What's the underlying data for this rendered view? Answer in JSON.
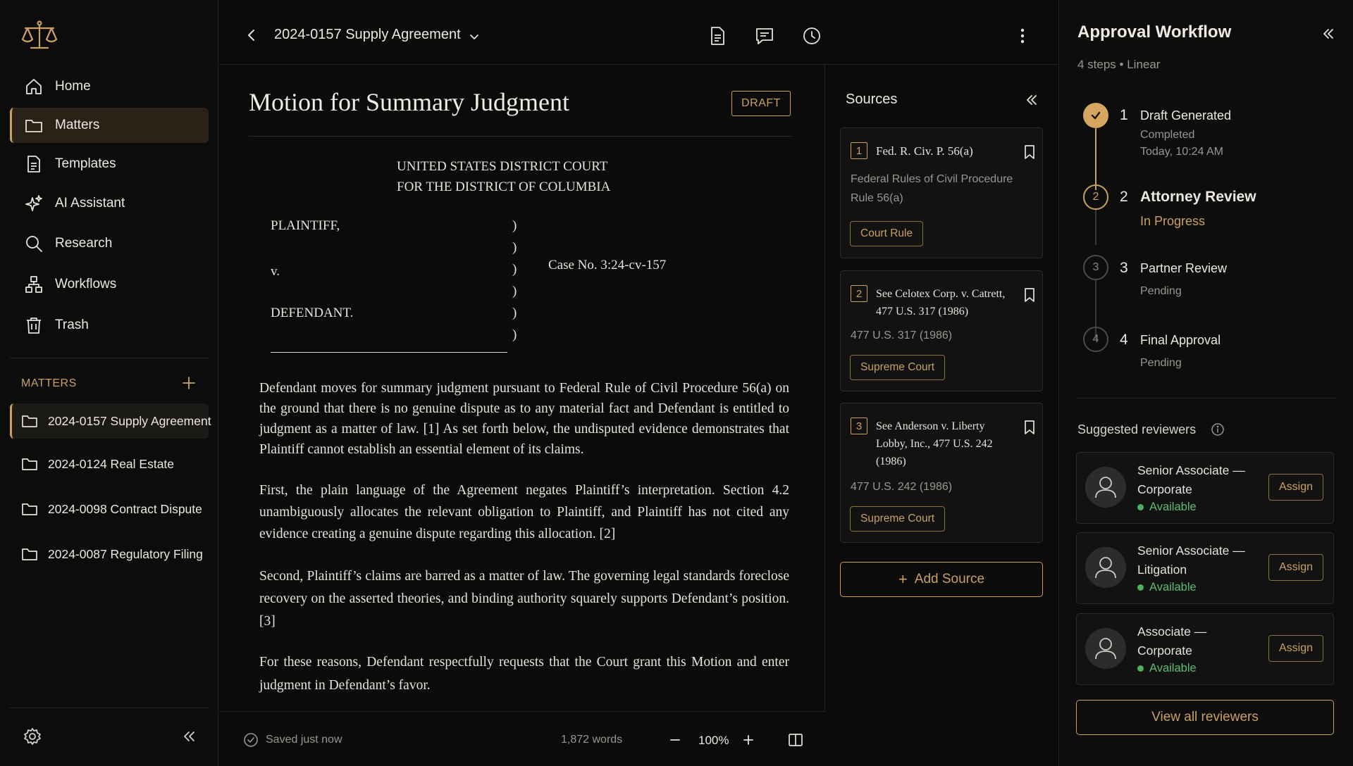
{
  "sidebar": {
    "nav": [
      {
        "label": "Home",
        "icon": "home-icon"
      },
      {
        "label": "Matters",
        "icon": "folder-icon",
        "active": true
      },
      {
        "label": "Templates",
        "icon": "document-icon"
      },
      {
        "label": "AI Assistant",
        "icon": "sparkle-icon"
      },
      {
        "label": "Research",
        "icon": "search-icon"
      },
      {
        "label": "Workflows",
        "icon": "workflow-icon"
      },
      {
        "label": "Trash",
        "icon": "trash-icon"
      }
    ],
    "matters_heading": "MATTERS",
    "matters": [
      {
        "label": "2024-0157 Supply Agreement",
        "active": true
      },
      {
        "label": "2024-0124 Real Estate"
      },
      {
        "label": "2024-0098 Contract Dispute"
      },
      {
        "label": "2024-0087 Regulatory Filing"
      }
    ]
  },
  "topbar": {
    "doc_title": "2024-0157 Supply Agreement"
  },
  "document": {
    "heading": "Motion for Summary Judgment",
    "badge": "DRAFT",
    "court_line1": "UNITED STATES DISTRICT COURT",
    "court_line2": "FOR THE DISTRICT OF COLUMBIA",
    "plaintiff": "PLAINTIFF,",
    "versus": "v.",
    "defendant": "DEFENDANT.",
    "paren": ")",
    "case_no": "Case No. 3:24-cv-157",
    "paragraphs": [
      "Defendant moves for summary judgment pursuant to Federal Rule of Civil Procedure 56(a) on the ground that there is no genuine dispute as to any material fact and Defendant is entitled to judgment as a matter of law. [1] As set forth below, the undisputed evidence demonstrates that Plaintiff cannot establish an essential element of its claims.",
      "First, the plain language of the Agreement negates Plaintiff’s interpretation. Section 4.2 unambiguously allocates the relevant obligation to Plaintiff, and Plaintiff has not cited any evidence creating a genuine dispute regarding this allocation. [2]",
      "Second, Plaintiff’s claims are barred as a matter of law. The governing legal standards foreclose recovery on the asserted theories, and binding authority squarely supports Defendant’s position. [3]",
      "For these reasons, Defendant respectfully requests that the Court grant this Motion and enter judgment in Defendant’s favor."
    ]
  },
  "statusbar": {
    "saved": "Saved just now",
    "words": "1,872 words",
    "zoom": "100%"
  },
  "sources": {
    "heading": "Sources",
    "items": [
      {
        "num": "1",
        "title": "Fed. R. Civ. P. 56(a)",
        "desc": "Federal Rules of Civil Procedure Rule 56(a)",
        "tag": "Court Rule"
      },
      {
        "num": "2",
        "title": "See Celotex Corp. v. Catrett, 477 U.S. 317 (1986)",
        "desc": "477 U.S. 317 (1986)",
        "tag": "Supreme Court"
      },
      {
        "num": "3",
        "title": "See Anderson v. Liberty Lobby, Inc., 477 U.S. 242 (1986)",
        "desc": "477 U.S. 242 (1986)",
        "tag": "Supreme Court"
      }
    ],
    "add_label": "Add Source"
  },
  "workflow": {
    "title": "Approval Workflow",
    "subtitle": "4 steps • Linear",
    "steps": [
      {
        "num": "1",
        "name": "Draft Generated",
        "status": "Completed",
        "time": "Today, 10:24 AM"
      },
      {
        "num": "2",
        "name": "Attorney Review",
        "status": "In Progress"
      },
      {
        "num": "3",
        "name": "Partner Review",
        "status": "Pending"
      },
      {
        "num": "4",
        "name": "Final Approval",
        "status": "Pending"
      }
    ],
    "reviewers_heading": "Suggested reviewers",
    "reviewers": [
      {
        "name": "Senior Associate — Corporate",
        "status": "Available",
        "action": "Assign"
      },
      {
        "name": "Senior Associate — Litigation",
        "status": "Available",
        "action": "Assign"
      },
      {
        "name": "Associate — Corporate",
        "status": "Available",
        "action": "Assign"
      }
    ],
    "view_all": "View all reviewers"
  },
  "colors": {
    "accent": "#c9a061",
    "background": "#0b0b0b",
    "available": "#5cbc6e"
  }
}
